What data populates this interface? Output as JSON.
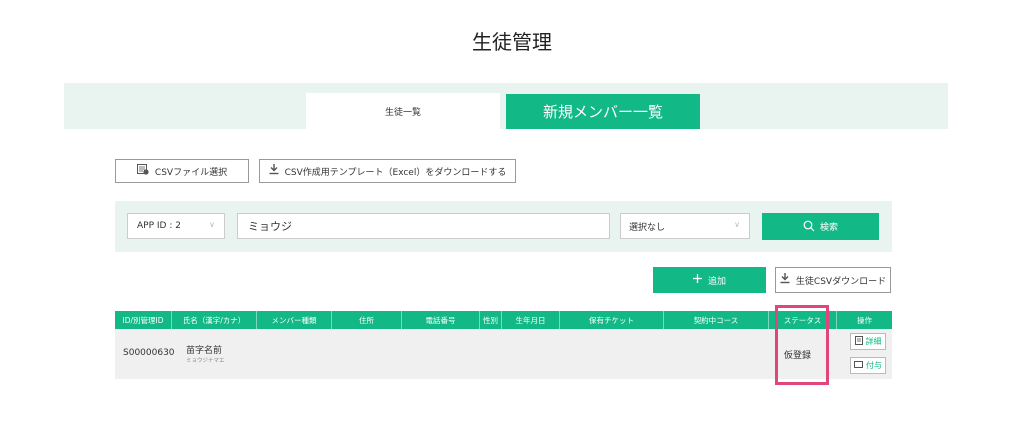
{
  "page": {
    "title": "生徒管理"
  },
  "tabs": [
    {
      "label": "生徒一覧",
      "active": true
    },
    {
      "label": "新規メンバー一覧",
      "active": false
    }
  ],
  "toolbar": {
    "csv_select_label": "CSVファイル選択",
    "template_download_label": "CSV作成用テンプレート（Excel）をダウンロードする"
  },
  "search": {
    "app_id_value": "APP ID : 2",
    "name_value": "ミョウジ",
    "status_value": "選択なし",
    "button_label": "検索"
  },
  "actions": {
    "add_label": "追加",
    "student_csv_download_label": "生徒CSVダウンロード"
  },
  "table": {
    "headers": [
      "ID/別管理ID",
      "氏名（漢字/カナ）",
      "メンバー種類",
      "住所",
      "電話番号",
      "性別",
      "生年月日",
      "保有チケット",
      "契約中コース",
      "ステータス",
      "操作"
    ],
    "rows": [
      {
        "id": "S00000630",
        "name": "苗字名前",
        "kana": "ミョウジナマエ",
        "status": "仮登録",
        "detail_label": "詳細",
        "grant_label": "付与"
      }
    ]
  },
  "colors": {
    "accent": "#12b886",
    "band": "#e9f3f0",
    "highlight": "#e0467c"
  },
  "icons": [
    "csv-file-icon",
    "download-icon",
    "chevron-down-icon",
    "search-icon",
    "plus-icon",
    "document-icon",
    "ticket-icon"
  ]
}
